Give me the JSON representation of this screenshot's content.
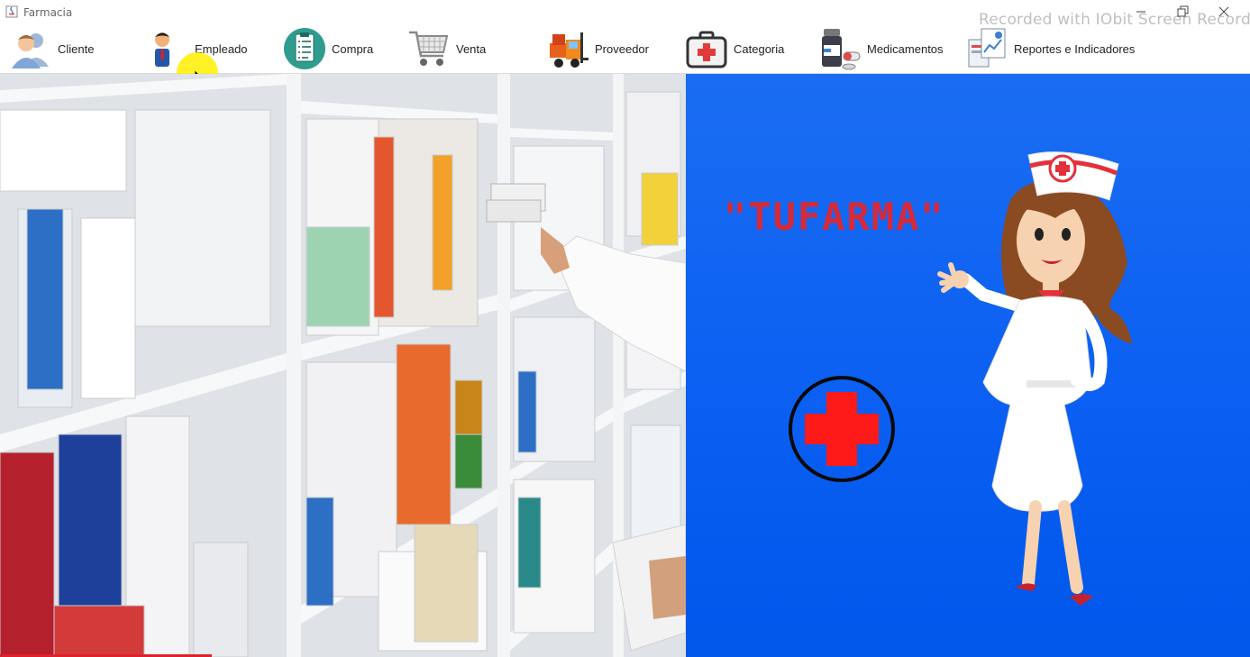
{
  "window": {
    "title": "Farmacia",
    "watermark": "Recorded with IObit Screen Recorder"
  },
  "toolbar": {
    "items": [
      {
        "label": "Cliente",
        "icon": "users-icon"
      },
      {
        "label": "Empleado",
        "icon": "employee-icon"
      },
      {
        "label": "Compra",
        "icon": "clipboard-icon"
      },
      {
        "label": "Venta",
        "icon": "shopping-cart-icon"
      },
      {
        "label": "Proveedor",
        "icon": "forklift-icon"
      },
      {
        "label": "Categoria",
        "icon": "first-aid-kit-icon"
      },
      {
        "label": "Medicamentos",
        "icon": "medicine-bottle-icon"
      },
      {
        "label": "Reportes e Indicadores",
        "icon": "report-chart-icon"
      }
    ]
  },
  "brand": {
    "title": "\"TUFARMA\""
  },
  "colors": {
    "brand_blue": "#0a5ef2",
    "brand_red": "#d62a3b",
    "cross_red": "#ff1a1a"
  }
}
